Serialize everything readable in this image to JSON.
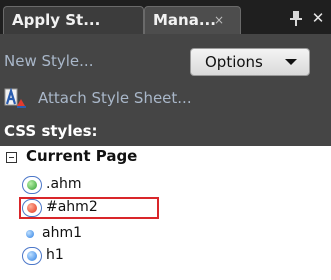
{
  "colors": {
    "panel_bg": "#454545",
    "link_text": "#a9b7c9",
    "selection_outline": "#d9262a"
  },
  "tabs": [
    {
      "label": "Apply St...",
      "active": false
    },
    {
      "label": "Mana...",
      "active": true,
      "close_glyph": "×"
    }
  ],
  "window_controls": {
    "pin_icon": "pin-icon",
    "close_glyph": "✕"
  },
  "toolbar": {
    "new_style_label": "New Style...",
    "options_label": "Options",
    "attach_label": "Attach Style Sheet...",
    "attach_icon": "stylesheet-icon"
  },
  "css_styles": {
    "heading": "CSS styles:",
    "group": "Current Page",
    "items": [
      {
        "label": ".ahm",
        "icon": "green-dot-icon",
        "ring": true,
        "selected": false
      },
      {
        "label": "#ahm2",
        "icon": "red-dot-icon",
        "ring": true,
        "selected": true
      },
      {
        "label": "ahm1",
        "icon": "blue-dot-icon",
        "ring": false,
        "selected": false
      },
      {
        "label": "h1",
        "icon": "blue-dot-icon",
        "ring": true,
        "selected": false
      }
    ]
  }
}
